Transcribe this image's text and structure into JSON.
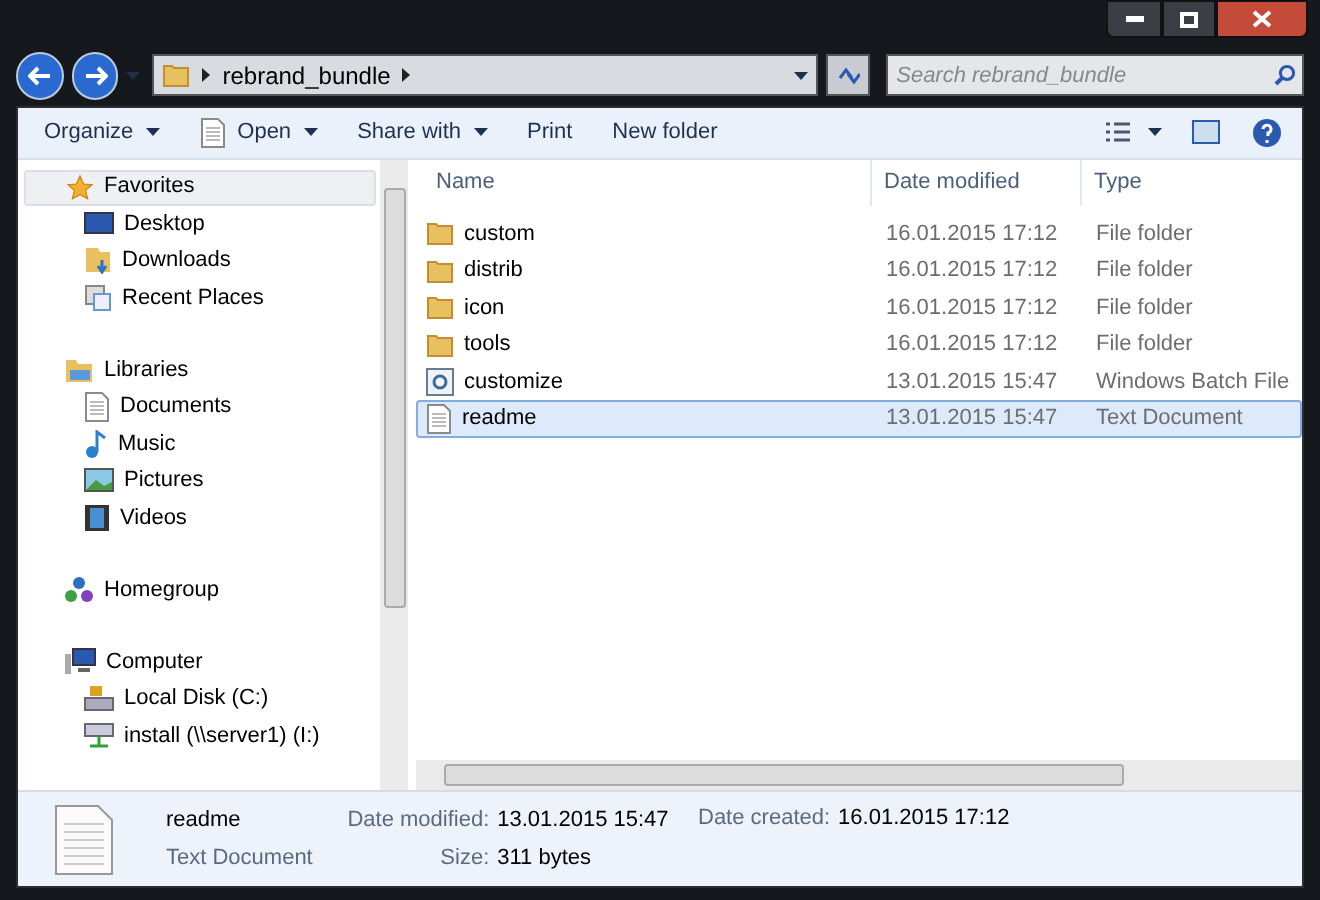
{
  "address_bar": {
    "crumbs": [
      "rebrand_bundle"
    ]
  },
  "search": {
    "placeholder": "Search rebrand_bundle"
  },
  "toolbar": [
    {
      "label": "Organize",
      "dropdown": true
    },
    {
      "label": "Open",
      "dropdown": true,
      "kind": "open"
    },
    {
      "label": "Share with",
      "dropdown": true
    },
    {
      "label": "Print",
      "dropdown": false
    },
    {
      "label": "New folder",
      "dropdown": false
    }
  ],
  "sidebar": {
    "groups": [
      {
        "label": "Favorites",
        "kind": "star",
        "selected": true,
        "children": [
          {
            "label": "Desktop",
            "kind": "desktop"
          },
          {
            "label": "Downloads",
            "kind": "downloads"
          },
          {
            "label": "Recent Places",
            "kind": "recent"
          }
        ]
      },
      {
        "label": "Libraries",
        "kind": "library",
        "selected": false,
        "children": [
          {
            "label": "Documents",
            "kind": "doc"
          },
          {
            "label": "Music",
            "kind": "music"
          },
          {
            "label": "Pictures",
            "kind": "pictures"
          },
          {
            "label": "Videos",
            "kind": "videos"
          }
        ]
      },
      {
        "label": "Homegroup",
        "kind": "homegroup",
        "selected": false
      },
      {
        "label": "Computer",
        "kind": "computer",
        "selected": false,
        "children": [
          {
            "label": "Local Disk (C:)",
            "kind": "disk"
          },
          {
            "label": "install (\\\\server1) (I:)",
            "kind": "netdrive"
          }
        ]
      }
    ]
  },
  "table": {
    "columns": [
      "Name",
      "Date modified",
      "Type"
    ],
    "rows": [
      {
        "name": "custom",
        "date": "16.01.2015 17:12",
        "type": "File folder",
        "kind": "folder",
        "selected": false
      },
      {
        "name": "distrib",
        "date": "16.01.2015 17:12",
        "type": "File folder",
        "kind": "folder",
        "selected": false
      },
      {
        "name": "icon",
        "date": "16.01.2015 17:12",
        "type": "File folder",
        "kind": "folder",
        "selected": false
      },
      {
        "name": "tools",
        "date": "16.01.2015 17:12",
        "type": "File folder",
        "kind": "folder",
        "selected": false
      },
      {
        "name": "customize",
        "date": "13.01.2015 15:47",
        "type": "Windows Batch File",
        "kind": "batch",
        "selected": false
      },
      {
        "name": "readme",
        "date": "13.01.2015 15:47",
        "type": "Text Document",
        "kind": "text",
        "selected": true
      }
    ]
  },
  "details": {
    "name": "readme",
    "type": "Text Document",
    "fields": [
      {
        "label": "Date modified:",
        "value": "13.01.2015 15:47"
      },
      {
        "label": "Size:",
        "value": "311 bytes"
      },
      {
        "label": "Date created:",
        "value": "16.01.2015 17:12"
      }
    ]
  }
}
